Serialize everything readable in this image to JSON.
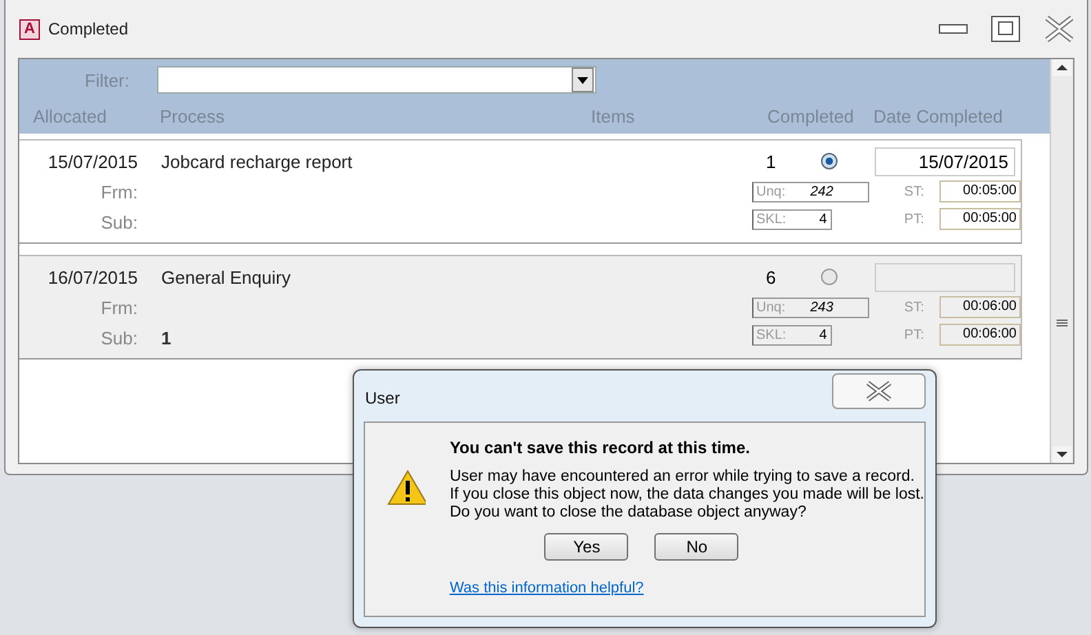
{
  "window": {
    "app_badge": "A",
    "title": "Completed"
  },
  "filter": {
    "label": "Filter:"
  },
  "columns": [
    "Allocated",
    "Process",
    "Items",
    "Completed",
    "Date Completed"
  ],
  "records": [
    {
      "current": true,
      "allocated": "15/07/2015",
      "process": "Jobcard recharge report",
      "frm_label": "Frm:",
      "sub_label": "Sub:",
      "items": "1",
      "completed": true,
      "date_completed": "15/07/2015",
      "unq_label": "Unq:",
      "unq": "242",
      "skl_label": "SKL:",
      "skl": "4",
      "st_label": "ST:",
      "st": "00:05:00",
      "pt_label": "PT:",
      "pt": "00:05:00"
    },
    {
      "current": false,
      "allocated": "16/07/2015",
      "process": "General Enquiry",
      "frm_label": "Frm:",
      "sub_label": "Sub:",
      "sub": "1",
      "items": "6",
      "completed": false,
      "unq_label": "Unq:",
      "unq": "243",
      "skl_label": "SKL:",
      "skl": "4",
      "st_label": "ST:",
      "st": "00:06:00",
      "pt_label": "PT:",
      "pt": "00:06:00"
    }
  ],
  "dialog": {
    "title": "User",
    "heading": "You can't save this record at this time.",
    "message_lines": [
      "User may have encountered an error while trying to save a record.",
      "If you close this object now, the data changes you made will be lost.",
      "Do you want to close the database object anyway?"
    ],
    "buttons": [
      "Yes",
      "No"
    ],
    "link": "Was this information helpful?"
  }
}
